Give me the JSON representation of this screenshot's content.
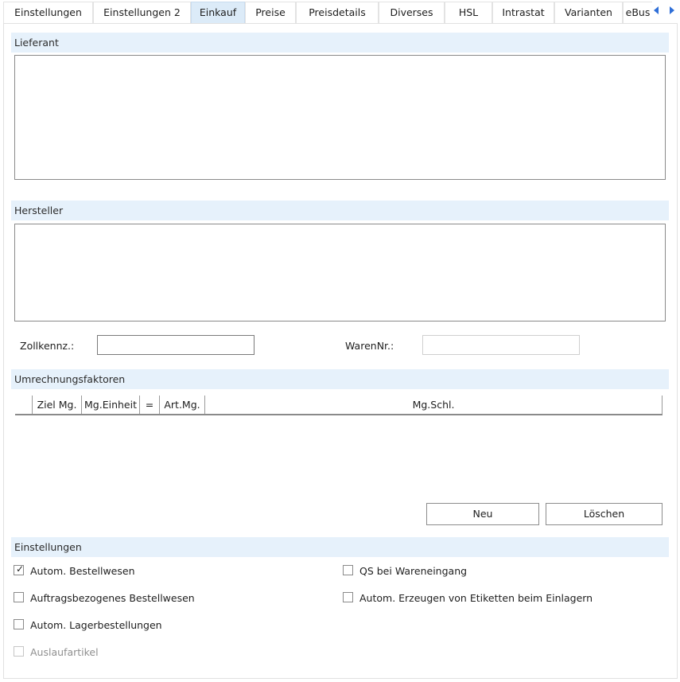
{
  "tabs": [
    {
      "label": "Einstellungen"
    },
    {
      "label": "Einstellungen 2"
    },
    {
      "label": "Einkauf"
    },
    {
      "label": "Preise"
    },
    {
      "label": "Preisdetails"
    },
    {
      "label": "Diverses"
    },
    {
      "label": "HSL"
    },
    {
      "label": "Intrastat"
    },
    {
      "label": "Varianten"
    },
    {
      "label": "eBus"
    }
  ],
  "active_tab": "Einkauf",
  "sections": {
    "lieferant": "Lieferant",
    "hersteller": "Hersteller",
    "umrechnungsfaktoren": "Umrechnungsfaktoren",
    "einstellungen": "Einstellungen"
  },
  "fields": {
    "zollkennz_label": "Zollkennz.:",
    "zollkennz_value": "",
    "warennr_label": "WarenNr.:",
    "warennr_value": ""
  },
  "grid": {
    "columns": [
      "Ziel Mg.",
      "Mg.Einheit",
      "=",
      "Art.Mg.",
      "Mg.Schl."
    ]
  },
  "buttons": {
    "new": "Neu",
    "delete": "Löschen"
  },
  "checkboxes": [
    {
      "label": "Autom. Bestellwesen",
      "checked": true,
      "enabled": true
    },
    {
      "label": "QS bei Wareneingang",
      "checked": false,
      "enabled": true
    },
    {
      "label": "Auftragsbezogenes Bestellwesen",
      "checked": false,
      "enabled": true
    },
    {
      "label": "Autom. Erzeugen von Etiketten beim Einlagern",
      "checked": false,
      "enabled": true
    },
    {
      "label": "Autom. Lagerbestellungen",
      "checked": false,
      "enabled": true
    },
    {
      "label": "Auslaufartikel",
      "checked": false,
      "enabled": false
    }
  ],
  "colors": {
    "section_bg": "#e6f1fb",
    "active_tab_bg": "#dcebf8",
    "nav_arrow": "#2f6fd8"
  },
  "icons": {
    "scroll_left": "arrow-left-icon",
    "scroll_right": "arrow-right-icon",
    "check": "checkmark-icon"
  }
}
